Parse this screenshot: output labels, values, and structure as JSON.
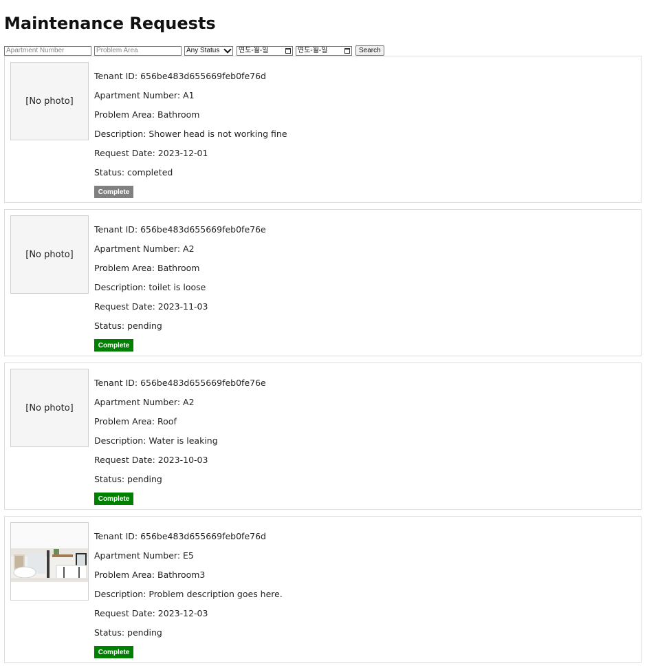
{
  "page": {
    "title": "Maintenance Requests"
  },
  "filters": {
    "apartment_placeholder": "Apartment Number",
    "problem_placeholder": "Problem Area",
    "status_selected": "Any Status",
    "date_from_placeholder": "연도-월-일",
    "date_to_placeholder": "연도-월-일",
    "search_label": "Search"
  },
  "colors": {
    "complete_active": "#008000",
    "complete_disabled": "#808080"
  },
  "requests": [
    {
      "photo_text": "[No photo]",
      "has_photo": false,
      "tenant_id": "Tenant ID: 656be483d655669feb0fe76d",
      "apartment": "Apartment Number: A1",
      "problem_area": "Problem Area: Bathroom",
      "description": "Description: Shower head is not working fine",
      "request_date": "Request Date: 2023-12-01",
      "status": "Status: completed",
      "button_label": "Complete",
      "button_disabled": true
    },
    {
      "photo_text": "[No photo]",
      "has_photo": false,
      "tenant_id": "Tenant ID: 656be483d655669feb0fe76e",
      "apartment": "Apartment Number: A2",
      "problem_area": "Problem Area: Bathroom",
      "description": "Description: toilet is loose",
      "request_date": "Request Date: 2023-11-03",
      "status": "Status: pending",
      "button_label": "Complete",
      "button_disabled": false
    },
    {
      "photo_text": "[No photo]",
      "has_photo": false,
      "tenant_id": "Tenant ID: 656be483d655669feb0fe76e",
      "apartment": "Apartment Number: A2",
      "problem_area": "Problem Area: Roof",
      "description": "Description: Water is leaking",
      "request_date": "Request Date: 2023-10-03",
      "status": "Status: pending",
      "button_label": "Complete",
      "button_disabled": false
    },
    {
      "photo_text": "",
      "has_photo": true,
      "tenant_id": "Tenant ID: 656be483d655669feb0fe76d",
      "apartment": "Apartment Number: E5",
      "problem_area": "Problem Area: Bathroom3",
      "description": "Description: Problem description goes here.",
      "request_date": "Request Date: 2023-12-03",
      "status": "Status: pending",
      "button_label": "Complete",
      "button_disabled": false
    }
  ]
}
